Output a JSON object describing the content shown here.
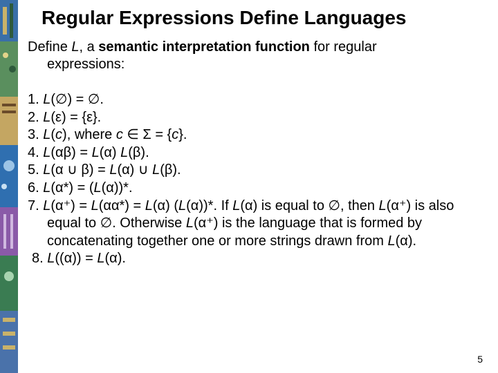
{
  "title": "Regular Expressions Define Languages",
  "intro_line1": "Define ",
  "intro_L": "L",
  "intro_after_L": ", a ",
  "intro_bold": "semantic interpretation function",
  "intro_after_bold": " for regular",
  "intro_line2": "expressions:",
  "rules": {
    "r1_a": "1. ",
    "r1_b": "L",
    "r1_c": "(∅) = ∅.",
    "r2_a": "2. ",
    "r2_b": "L",
    "r2_c": "(ε) = {ε}.",
    "r3_a": "3. ",
    "r3_b": "L",
    "r3_c": "(",
    "r3_d": "c",
    "r3_e": "), where ",
    "r3_f": "c",
    "r3_g": " ∈ Σ = {",
    "r3_h": "c",
    "r3_i": "}.",
    "r4_a": "4. ",
    "r4_b": "L",
    "r4_c": "(αβ) = ",
    "r4_d": "L",
    "r4_e": "(α) ",
    "r4_f": "L",
    "r4_g": "(β).",
    "r5_a": "5. ",
    "r5_b": "L",
    "r5_c": "(α ∪ β) = ",
    "r5_d": "L",
    "r5_e": "(α) ∪ ",
    "r5_f": "L",
    "r5_g": "(β).",
    "r6_a": "6. ",
    "r6_b": "L",
    "r6_c": "(α*) = (",
    "r6_d": "L",
    "r6_e": "(α))*.",
    "r7_a": "7. ",
    "r7_b": "L",
    "r7_c": "(α⁺) = ",
    "r7_d": "L",
    "r7_e": "(αα*) = ",
    "r7_f": "L",
    "r7_g": "(α) (",
    "r7_h": "L",
    "r7_i": "(α))*.  If ",
    "r7_j": "L",
    "r7_k": "(α) is equal to ∅, then ",
    "r7_l": "L",
    "r7_m": "(α⁺) is also equal to ∅.  Otherwise ",
    "r7_n": "L",
    "r7_o": "(α⁺) is the language that is formed by concatenating together one or more strings drawn from ",
    "r7_p": "L",
    "r7_q": "(α).",
    "r8_a": " 8. ",
    "r8_b": "L",
    "r8_c": "((α)) = ",
    "r8_d": "L",
    "r8_e": "(α)."
  },
  "page_number": "5"
}
